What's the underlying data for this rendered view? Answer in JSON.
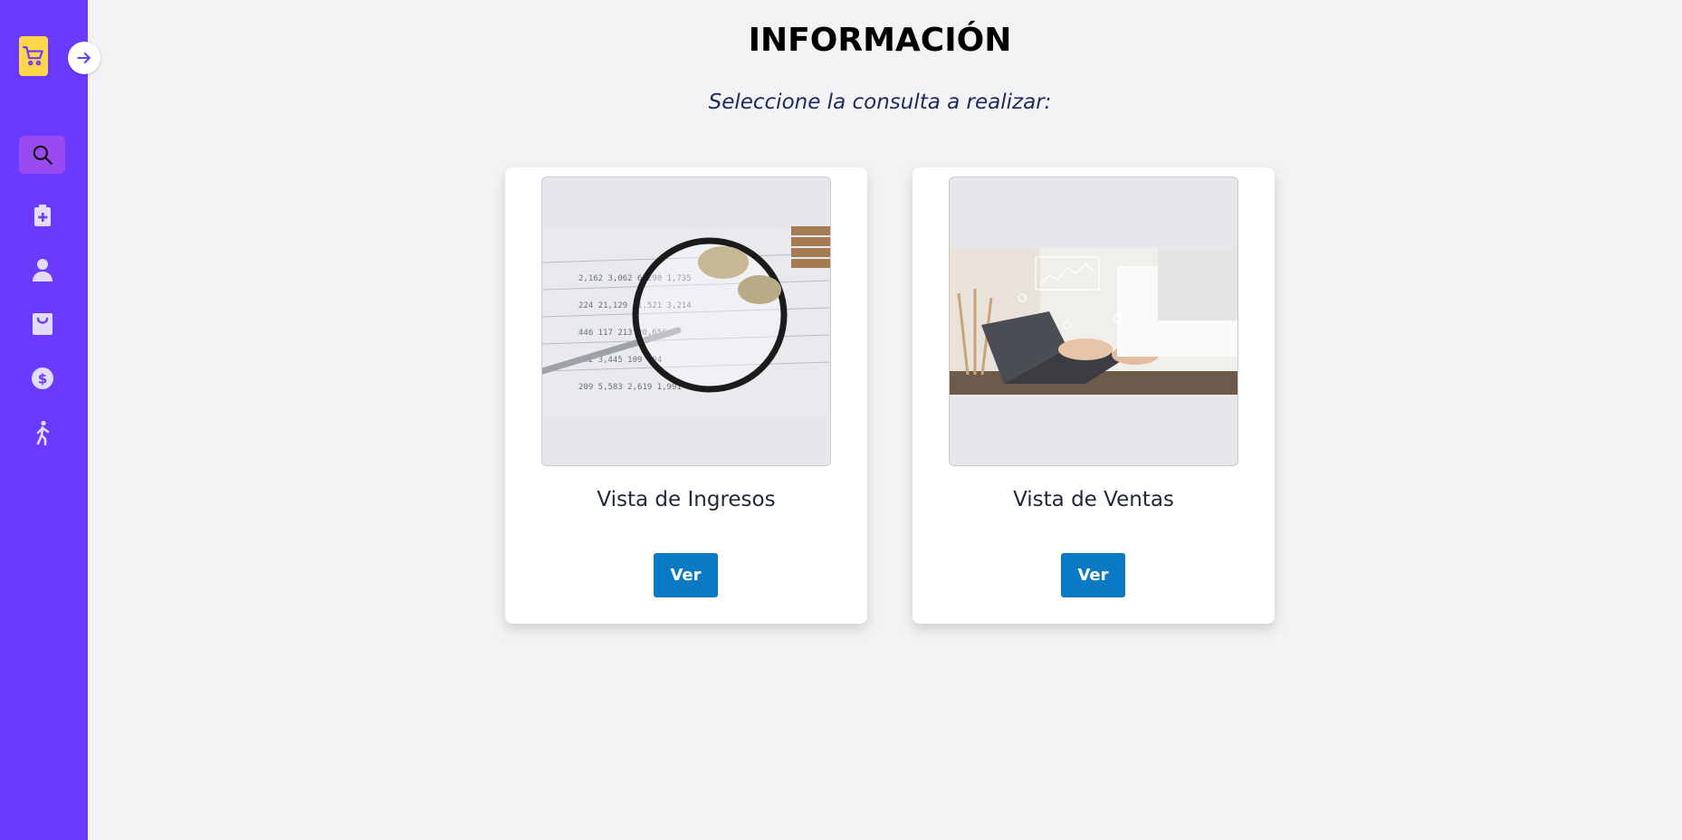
{
  "sidebar": {
    "logo_icon": "shopping-cart-icon",
    "toggle_icon": "arrow-right-icon",
    "items": [
      {
        "icon": "search-icon",
        "active": true
      },
      {
        "icon": "clipboard-plus-icon",
        "active": false
      },
      {
        "icon": "user-icon",
        "active": false
      },
      {
        "icon": "shopping-bag-icon",
        "active": false
      },
      {
        "icon": "dollar-circle-icon",
        "active": false
      },
      {
        "icon": "walking-person-icon",
        "active": false
      }
    ]
  },
  "main": {
    "title": "INFORMACIÓN",
    "subtitle": "Seleccione la consulta a realizar:",
    "cards": [
      {
        "title": "Vista de Ingresos",
        "button_label": "Ver",
        "image": "magnifier-financial-report-photo"
      },
      {
        "title": "Vista de Ventas",
        "button_label": "Ver",
        "image": "laptop-data-analytics-photo"
      }
    ]
  },
  "colors": {
    "sidebar": "#6a3aff",
    "active_item": "#9a4af2",
    "logo": "#ffd54a",
    "button": "#0a7ac4",
    "background": "#f2f3f5"
  }
}
